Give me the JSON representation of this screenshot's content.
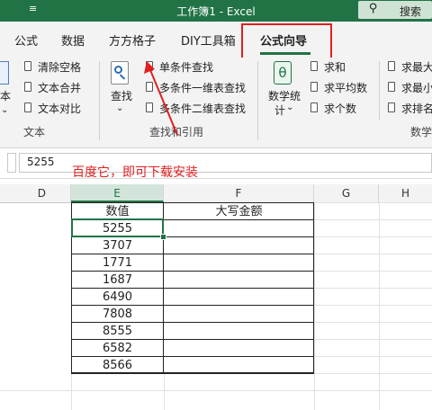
{
  "titlebar": {
    "title": "工作簿1  -  Excel",
    "qat_more": "≡",
    "search_label": "搜索",
    "search_icon": "search-icon"
  },
  "tabs": [
    {
      "label": "公式"
    },
    {
      "label": "数据"
    },
    {
      "label": "方方格子"
    },
    {
      "label": "DIY工具箱"
    },
    {
      "label": "公式向导",
      "active": true
    }
  ],
  "ribbon": {
    "text_group": {
      "big_button_partial": "本",
      "items": [
        "清除空格",
        "文本合并",
        "文本对比"
      ],
      "label": "文本"
    },
    "lookup_group": {
      "find_button": "查找",
      "items": [
        "单条件查找",
        "多条件一维表查找",
        "多条件二维表查找"
      ],
      "label": "查找和引用"
    },
    "math_group": {
      "stats_button_line1": "数学统",
      "stats_button_line2": "计",
      "theta_symbol": "θ",
      "items": [
        "求和",
        "求平均数",
        "求个数"
      ],
      "right_items": [
        "求最大",
        "求最小",
        "求排名"
      ],
      "label": "数学"
    }
  },
  "formula_bar": {
    "value": "5255"
  },
  "annotation": {
    "text": "百度它，即可下载安装",
    "color": "#e02020"
  },
  "columns": [
    "D",
    "E",
    "F",
    "G",
    "H"
  ],
  "selected_column": "E",
  "table": {
    "headers": [
      "数值",
      "大写金额"
    ],
    "values": [
      "5255",
      "3707",
      "1771",
      "1687",
      "6490",
      "7808",
      "8555",
      "6582",
      "8566"
    ]
  },
  "colors": {
    "excel_green": "#217346",
    "annotation_red": "#e02020"
  }
}
